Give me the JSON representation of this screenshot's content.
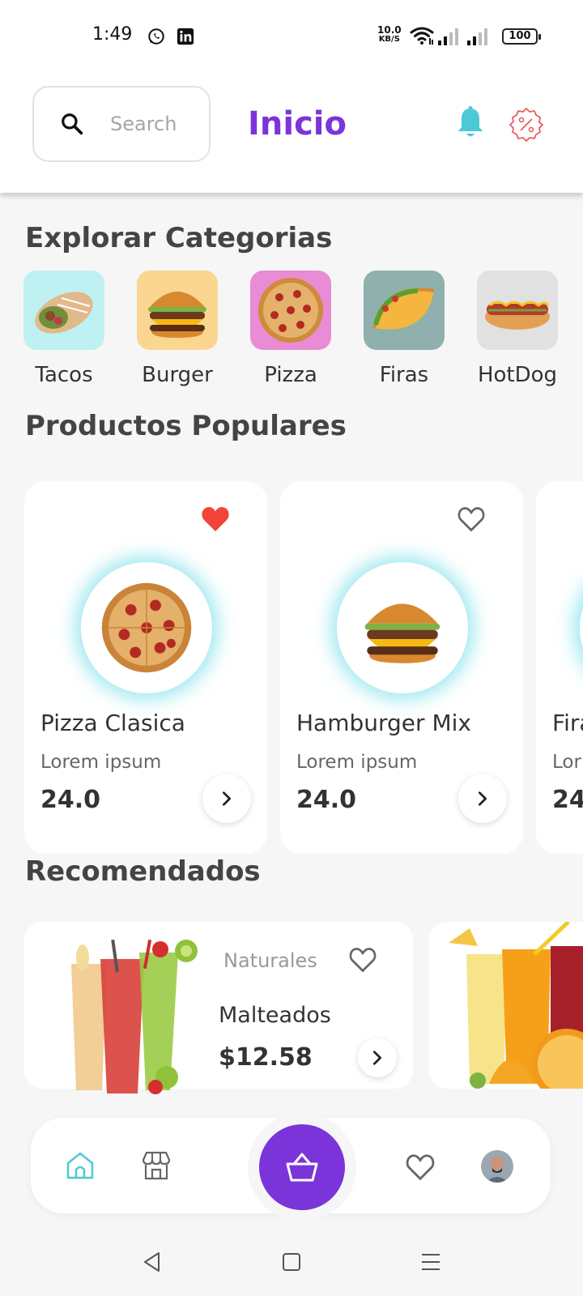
{
  "status_bar": {
    "time": "1:49",
    "net_speed_value": "10.0",
    "net_speed_unit": "KB/S",
    "battery": "100"
  },
  "header": {
    "search_placeholder": "Search",
    "title": "Inicio"
  },
  "sections": {
    "categories_title": "Explorar Categorias",
    "popular_title": "Productos Populares",
    "recommended_title": "Recomendados"
  },
  "categories": [
    {
      "label": "Tacos",
      "bg": "#bff0f2"
    },
    {
      "label": "Burger",
      "bg": "#fbd691"
    },
    {
      "label": "Pizza",
      "bg": "#e98bd5"
    },
    {
      "label": "Firas",
      "bg": "#8fb0ac"
    },
    {
      "label": "HotDog",
      "bg": "#e1e1e1"
    }
  ],
  "products": [
    {
      "name": "Pizza Clasica",
      "description": "Lorem ipsum",
      "price": "24.0",
      "favorite": true
    },
    {
      "name": "Hamburger Mix",
      "description": "Lorem ipsum",
      "price": "24.0",
      "favorite": false
    },
    {
      "name": "Fira",
      "description": "Lor",
      "price": "24"
    }
  ],
  "recommended": [
    {
      "category": "Naturales",
      "title": "Malteados",
      "price": "$12.58",
      "favorite": false
    }
  ],
  "colors": {
    "accent": "#7b34d9",
    "teal": "#4cc9d6",
    "favorite_red": "#f04438",
    "promo_red": "#e85d5d"
  },
  "icons": {
    "search": "search-icon",
    "notifications": "bell-icon",
    "promotions": "discount-badge-icon",
    "favorite": "heart-icon",
    "next": "chevron-right-icon",
    "home": "home-icon",
    "store": "store-icon",
    "cart": "basket-icon"
  }
}
